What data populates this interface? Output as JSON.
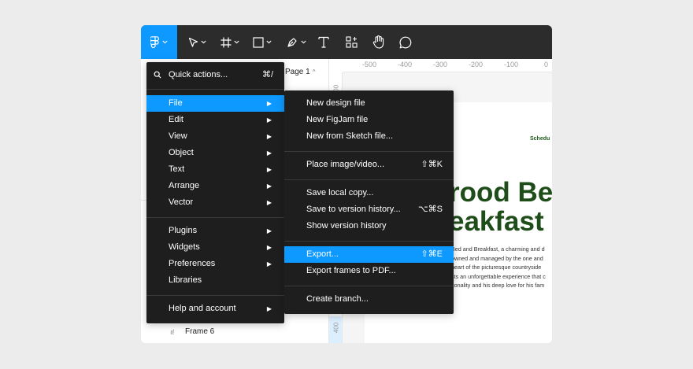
{
  "toolbar": {
    "tools": [
      {
        "icon": "figma-logo-icon"
      },
      {
        "icon": "move-tool-icon"
      },
      {
        "icon": "frame-tool-icon"
      },
      {
        "icon": "rectangle-tool-icon"
      },
      {
        "icon": "pen-tool-icon"
      },
      {
        "icon": "text-tool-icon"
      },
      {
        "icon": "resources-icon"
      },
      {
        "icon": "hand-tool-icon"
      },
      {
        "icon": "comment-tool-icon"
      }
    ],
    "accent_color": "#0d99ff"
  },
  "left_panel": {
    "page_label": "Page 1",
    "page_caret": "^",
    "layers": [
      {
        "label": "Frame 6"
      }
    ]
  },
  "rulers": {
    "top_ticks": [
      "-500",
      "-400",
      "-300",
      "-200",
      "-100",
      "0"
    ],
    "left_ticks": [
      "300",
      "400"
    ]
  },
  "canvas": {
    "schedule": "Schedu",
    "headline_line1": "rood Bed",
    "headline_line2": "eakfast",
    "paragraph_lines": [
      "Bed and Breakfast, a charming and d",
      "owned and managed by the one and",
      "heart of the picturesque countryside",
      "sts an unforgettable experience that c",
      "sonality and his deep love for his fam"
    ],
    "headline_color": "#1f4d1a"
  },
  "main_menu": {
    "quick_actions": {
      "label": "Quick actions...",
      "shortcut": "⌘/"
    },
    "items": [
      {
        "label": "File",
        "has_submenu": true,
        "selected": true
      },
      {
        "label": "Edit",
        "has_submenu": true
      },
      {
        "label": "View",
        "has_submenu": true
      },
      {
        "label": "Object",
        "has_submenu": true
      },
      {
        "label": "Text",
        "has_submenu": true
      },
      {
        "label": "Arrange",
        "has_submenu": true
      },
      {
        "label": "Vector",
        "has_submenu": true
      },
      {
        "label": "Plugins",
        "has_submenu": true
      },
      {
        "label": "Widgets",
        "has_submenu": true
      },
      {
        "label": "Preferences",
        "has_submenu": true
      },
      {
        "label": "Libraries",
        "has_submenu": false
      },
      {
        "label": "Help and account",
        "has_submenu": true
      }
    ],
    "submenu_arrow": "▶"
  },
  "file_submenu": {
    "items": [
      {
        "label": "New design file",
        "shortcut": ""
      },
      {
        "label": "New FigJam file",
        "shortcut": ""
      },
      {
        "label": "New from Sketch file...",
        "shortcut": ""
      },
      {
        "label": "Place image/video...",
        "shortcut": "⇧⌘K"
      },
      {
        "label": "Save local copy...",
        "shortcut": ""
      },
      {
        "label": "Save to version history...",
        "shortcut": "⌥⌘S"
      },
      {
        "label": "Show version history",
        "shortcut": ""
      },
      {
        "label": "Export...",
        "shortcut": "⇧⌘E",
        "selected": true
      },
      {
        "label": "Export frames to PDF...",
        "shortcut": ""
      },
      {
        "label": "Create branch...",
        "shortcut": ""
      }
    ]
  }
}
